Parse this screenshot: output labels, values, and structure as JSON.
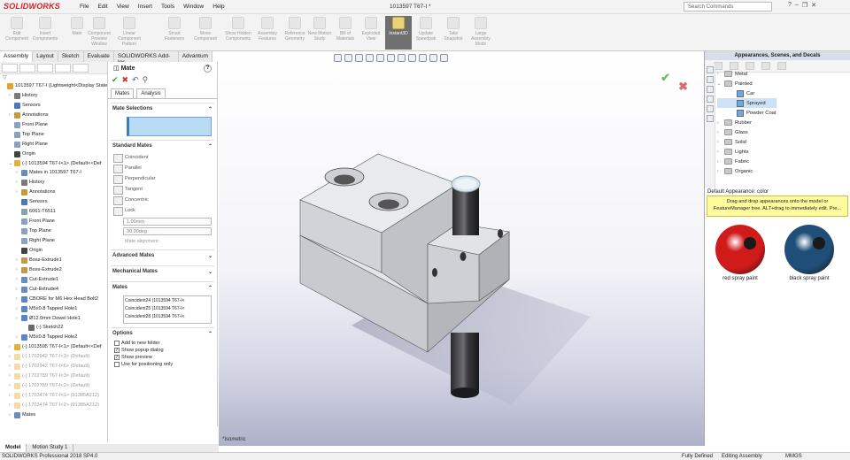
{
  "titlebar": {
    "logo": "SOLIDWORKS",
    "menus": [
      "File",
      "Edit",
      "View",
      "Insert",
      "Tools",
      "Window",
      "Help"
    ],
    "document_title": "1013597 T67-I *",
    "search_placeholder": "Search Commands"
  },
  "ribbon": {
    "buttons": [
      {
        "label": "Edit Component",
        "icon": "edit-component-icon"
      },
      {
        "label": "Insert Components",
        "icon": "insert-components-icon"
      },
      {
        "label": "Mate",
        "icon": "mate-icon"
      },
      {
        "label": "Component Preview Window",
        "icon": "preview-window-icon"
      },
      {
        "label": "Linear Component Pattern",
        "icon": "linear-pattern-icon"
      },
      {
        "label": "Smart Fasteners",
        "icon": "smart-fasteners-icon"
      },
      {
        "label": "Move Component",
        "icon": "move-component-icon"
      },
      {
        "label": "Show Hidden Components",
        "icon": "show-hidden-icon"
      },
      {
        "label": "Assembly Features",
        "icon": "assembly-features-icon"
      },
      {
        "label": "Reference Geometry",
        "icon": "reference-geometry-icon"
      },
      {
        "label": "New Motion Study",
        "icon": "motion-study-icon"
      },
      {
        "label": "Bill of Materials",
        "icon": "bom-icon"
      },
      {
        "label": "Exploded View",
        "icon": "exploded-view-icon"
      },
      {
        "label": "Instant3D",
        "icon": "instant3d-icon",
        "active": true
      },
      {
        "label": "Update Speedpak",
        "icon": "speedpak-icon"
      },
      {
        "label": "Take Snapshot",
        "icon": "snapshot-icon"
      },
      {
        "label": "Large Assembly Mode",
        "icon": "large-assembly-icon"
      }
    ]
  },
  "tabs": [
    "Assembly",
    "Layout",
    "Sketch",
    "Evaluate",
    "SOLIDWORKS Add-Ins",
    "Advantum"
  ],
  "feature_tree": {
    "items": [
      {
        "label": "1013597 T67-I  (Lightweight<Display State",
        "icon": "assembly-icon",
        "depth": 0,
        "arrow": "",
        "dim": false
      },
      {
        "label": "History",
        "icon": "history-icon",
        "depth": 1,
        "arrow": ">",
        "dim": false
      },
      {
        "label": "Sensors",
        "icon": "sensors-icon",
        "depth": 1,
        "arrow": "",
        "dim": false
      },
      {
        "label": "Annotations",
        "icon": "annotations-icon",
        "depth": 1,
        "arrow": ">",
        "dim": false
      },
      {
        "label": "Front Plane",
        "icon": "plane-icon",
        "depth": 1,
        "arrow": "",
        "dim": false
      },
      {
        "label": "Top Plane",
        "icon": "plane-icon",
        "depth": 1,
        "arrow": "",
        "dim": false
      },
      {
        "label": "Right Plane",
        "icon": "plane-icon",
        "depth": 1,
        "arrow": "",
        "dim": false
      },
      {
        "label": "Origin",
        "icon": "origin-icon",
        "depth": 1,
        "arrow": "",
        "dim": false
      },
      {
        "label": "(-) 1013594 T67-I<1> (Default<<Def",
        "icon": "part-icon",
        "depth": 1,
        "arrow": "v",
        "dim": false
      },
      {
        "label": "Mates in 1013597 T67-I",
        "icon": "mates-icon",
        "depth": 2,
        "arrow": ">",
        "dim": false
      },
      {
        "label": "History",
        "icon": "history-icon",
        "depth": 2,
        "arrow": ">",
        "dim": false
      },
      {
        "label": "Annotations",
        "icon": "annotations-icon",
        "depth": 2,
        "arrow": ">",
        "dim": false
      },
      {
        "label": "Sensors",
        "icon": "sensors-icon",
        "depth": 2,
        "arrow": "",
        "dim": false
      },
      {
        "label": "6061-T6511",
        "icon": "material-icon",
        "depth": 2,
        "arrow": "",
        "dim": false
      },
      {
        "label": "Front Plane",
        "icon": "plane-icon",
        "depth": 2,
        "arrow": "",
        "dim": false
      },
      {
        "label": "Top Plane",
        "icon": "plane-icon",
        "depth": 2,
        "arrow": "",
        "dim": false
      },
      {
        "label": "Right Plane",
        "icon": "plane-icon",
        "depth": 2,
        "arrow": "",
        "dim": false
      },
      {
        "label": "Origin",
        "icon": "origin-icon",
        "depth": 2,
        "arrow": "",
        "dim": false
      },
      {
        "label": "Boss-Extrude1",
        "icon": "extrude-icon",
        "depth": 2,
        "arrow": ">",
        "dim": false
      },
      {
        "label": "Boss-Extrude2",
        "icon": "extrude-icon",
        "depth": 2,
        "arrow": ">",
        "dim": false
      },
      {
        "label": "Cut-Extrude1",
        "icon": "cut-icon",
        "depth": 2,
        "arrow": ">",
        "dim": false
      },
      {
        "label": "Cut-Extrude4",
        "icon": "cut-icon",
        "depth": 2,
        "arrow": ">",
        "dim": false
      },
      {
        "label": "CBORE for M6 Hex Head Bolt2",
        "icon": "hole-icon",
        "depth": 2,
        "arrow": ">",
        "dim": false
      },
      {
        "label": "M5x0.8 Tapped Hole1",
        "icon": "hole-icon",
        "depth": 2,
        "arrow": ">",
        "dim": false
      },
      {
        "label": "Ø12.0mm Dowel Hole1",
        "icon": "hole-icon",
        "depth": 2,
        "arrow": ">",
        "dim": false
      },
      {
        "label": "(-) Sketch22",
        "icon": "sketch-icon",
        "depth": 3,
        "arrow": "",
        "dim": false
      },
      {
        "label": "M5x0.8 Tapped Hole2",
        "icon": "hole-icon",
        "depth": 2,
        "arrow": ">",
        "dim": false
      },
      {
        "label": "(-) 1013595 T67-I<1> (Default<<Def",
        "icon": "part-icon",
        "depth": 1,
        "arrow": ">",
        "dim": false
      },
      {
        "label": "(-) 1702942 T67-I<3> (Default)",
        "icon": "part-icon",
        "depth": 1,
        "arrow": ">",
        "dim": true
      },
      {
        "label": "(-) 1702942 T67-I<6> (Default)",
        "icon": "part-icon",
        "depth": 1,
        "arrow": ">",
        "dim": true
      },
      {
        "label": "(-) 1702789 T67-I<3> (Default)",
        "icon": "part-icon",
        "depth": 1,
        "arrow": ">",
        "dim": true
      },
      {
        "label": "(-) 1702789 T67-I<2> (Default)",
        "icon": "part-icon",
        "depth": 1,
        "arrow": ">",
        "dim": true
      },
      {
        "label": "(-) 1703474 T67-I<1> (91385A212)",
        "icon": "part-icon",
        "depth": 1,
        "arrow": ">",
        "dim": true
      },
      {
        "label": "(-) 1703474 T67-I<2> (91385A212)",
        "icon": "part-icon",
        "depth": 1,
        "arrow": ">",
        "dim": true
      },
      {
        "label": "Mates",
        "icon": "mates-icon",
        "depth": 1,
        "arrow": ">",
        "dim": false
      }
    ]
  },
  "property_manager": {
    "title": "Mate",
    "help": "?",
    "tabs": [
      "Mates",
      "Analysis"
    ],
    "mate_selections": "Mate Selections",
    "standard_mates": {
      "title": "Standard Mates",
      "items": [
        "Coincident",
        "Parallel",
        "Perpendicular",
        "Tangent",
        "Concentric",
        "Lock"
      ]
    },
    "distance_value": "1.00mm",
    "angle_value": "30.00deg",
    "mate_alignment": "Mate alignment:",
    "advanced_mates": "Advanced Mates",
    "mechanical_mates": "Mechanical Mates",
    "mates": {
      "title": "Mates",
      "items": [
        "Coincident24 (1013594 T67-I<",
        "Coincident25 (1013594 T67-I<",
        "Coincident28 (1013594 T67-I<"
      ]
    },
    "options": {
      "title": "Options",
      "items": [
        {
          "label": "Add to new folder",
          "checked": false
        },
        {
          "label": "Show popup dialog",
          "checked": true
        },
        {
          "label": "Show preview",
          "checked": true
        },
        {
          "label": "Use for positioning only",
          "checked": false
        }
      ]
    }
  },
  "viewport": {
    "view_label": "*Isometric"
  },
  "task_pane": {
    "title": "Appearances, Scenes, and Decals",
    "tree": [
      {
        "label": "Metal",
        "depth": 0,
        "arrow": ">",
        "type": "folder",
        "selected": false
      },
      {
        "label": "Painted",
        "depth": 0,
        "arrow": "v",
        "type": "folder",
        "selected": false
      },
      {
        "label": "Car",
        "depth": 1,
        "arrow": "",
        "type": "swatch",
        "selected": false
      },
      {
        "label": "Sprayed",
        "depth": 1,
        "arrow": "",
        "type": "swatch",
        "selected": true
      },
      {
        "label": "Powder Coat",
        "depth": 1,
        "arrow": "",
        "type": "swatch",
        "selected": false
      },
      {
        "label": "Rubber",
        "depth": 0,
        "arrow": ">",
        "type": "folder",
        "selected": false
      },
      {
        "label": "Glass",
        "depth": 0,
        "arrow": ">",
        "type": "folder",
        "selected": false
      },
      {
        "label": "Solid",
        "depth": 0,
        "arrow": ">",
        "type": "folder",
        "selected": false
      },
      {
        "label": "Lights",
        "depth": 0,
        "arrow": ">",
        "type": "folder",
        "selected": false
      },
      {
        "label": "Fabric",
        "depth": 0,
        "arrow": ">",
        "type": "folder",
        "selected": false
      },
      {
        "label": "Organic",
        "depth": 0,
        "arrow": ">",
        "type": "folder",
        "selected": false
      }
    ],
    "default_label": "Default Appearance: color",
    "tip": "Drag and drop appearances onto the model or FeatureManager tree.  ALT+drag to immediately edit.  Pre...",
    "swatches": [
      {
        "label": "red spray paint",
        "color": "#d11a1a"
      },
      {
        "label": "black spray paint",
        "color": "#1f4f78"
      }
    ]
  },
  "bottom_tabs": [
    "Model",
    "Motion Study 1"
  ],
  "statusbar": {
    "app": "SOLIDWORKS Professional 2018 SP4.0",
    "definition": "Fully Defined",
    "mode": "Editing Assembly",
    "units": "MMGS"
  }
}
